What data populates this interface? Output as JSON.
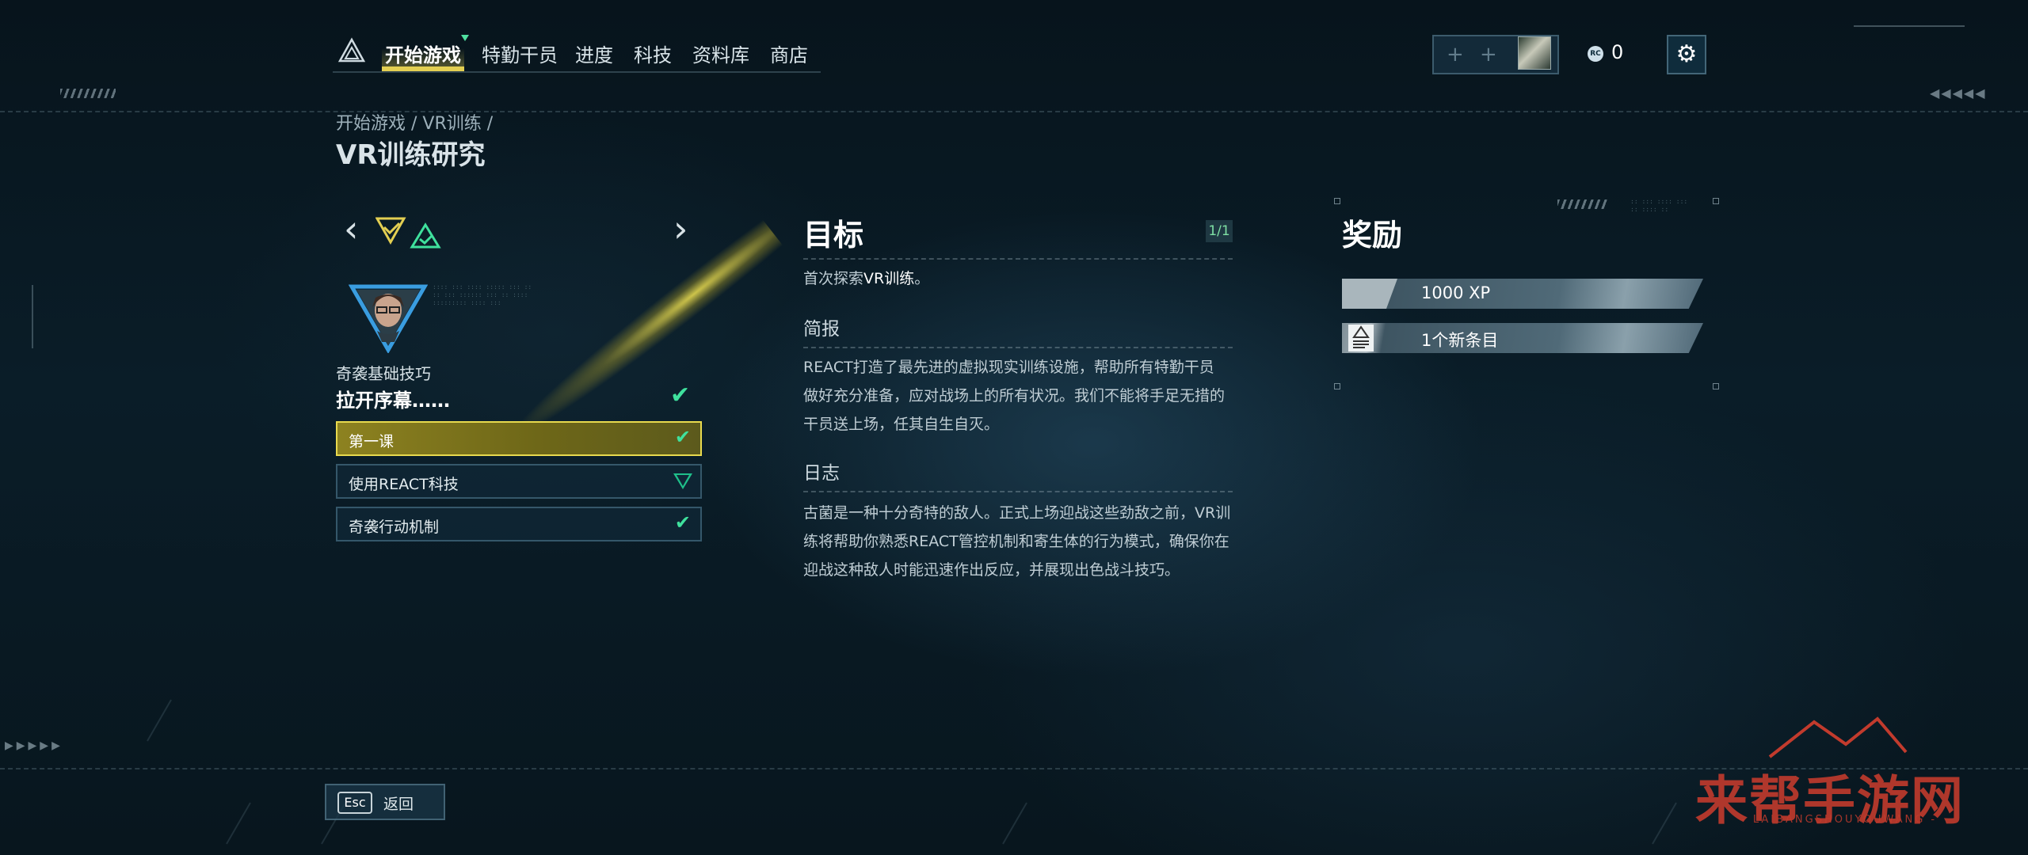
{
  "nav": {
    "items": [
      {
        "label": "开始游戏",
        "active": true
      },
      {
        "label": "特勤干员",
        "active": false
      },
      {
        "label": "进度",
        "active": false
      },
      {
        "label": "科技",
        "active": false
      },
      {
        "label": "资料库",
        "active": false
      },
      {
        "label": "商店",
        "active": false
      }
    ]
  },
  "top_right": {
    "party_slots": [
      "+",
      "+"
    ],
    "coin_icon_text": "RC",
    "coin_value": "0"
  },
  "header": {
    "breadcrumb": "开始游戏 / VR训练 /",
    "title": "VR训练研究"
  },
  "left_panel": {
    "section_subtitle": "奇袭基础技巧",
    "section_title": "拉开序幕……",
    "lessons": [
      {
        "label": "第一课",
        "status": "complete",
        "active": true
      },
      {
        "label": "使用REACT科技",
        "status": "new",
        "active": false
      },
      {
        "label": "奇袭行动机制",
        "status": "complete",
        "active": false
      }
    ]
  },
  "objective": {
    "heading": "目标",
    "page_indicator": "1/1",
    "text_prefix": "首次探索",
    "text_highlight": "VR训练",
    "text_suffix": "。"
  },
  "briefing": {
    "heading": "简报",
    "text": "REACT打造了最先进的虚拟现实训练设施，帮助所有特勤干员做好充分准备，应对战场上的所有状况。我们不能将手足无措的干员送上场，任其自生自灭。"
  },
  "log": {
    "heading": "日志",
    "text": "古菌是一种十分奇特的敌人。正式上场迎战这些劲敌之前，VR训练将帮助你熟悉REACT管控机制和寄生体的行为模式，确保你在迎战这种敌人时能迅速作出反应，并展现出色战斗技巧。"
  },
  "rewards": {
    "heading": "奖励",
    "items": [
      {
        "label": "1000 XP",
        "icon": "xp"
      },
      {
        "label": "1个新条目",
        "icon": "document-icon"
      }
    ]
  },
  "footer": {
    "esc_key": "Esc",
    "back_label": "返回"
  },
  "watermark": {
    "main": "来帮手游网",
    "sub": "- LAIBANGSHOUYOUWANG -"
  },
  "colors": {
    "accent_yellow": "#e3cf52",
    "check_green": "#3fe19d",
    "background": "#0a1d28"
  }
}
